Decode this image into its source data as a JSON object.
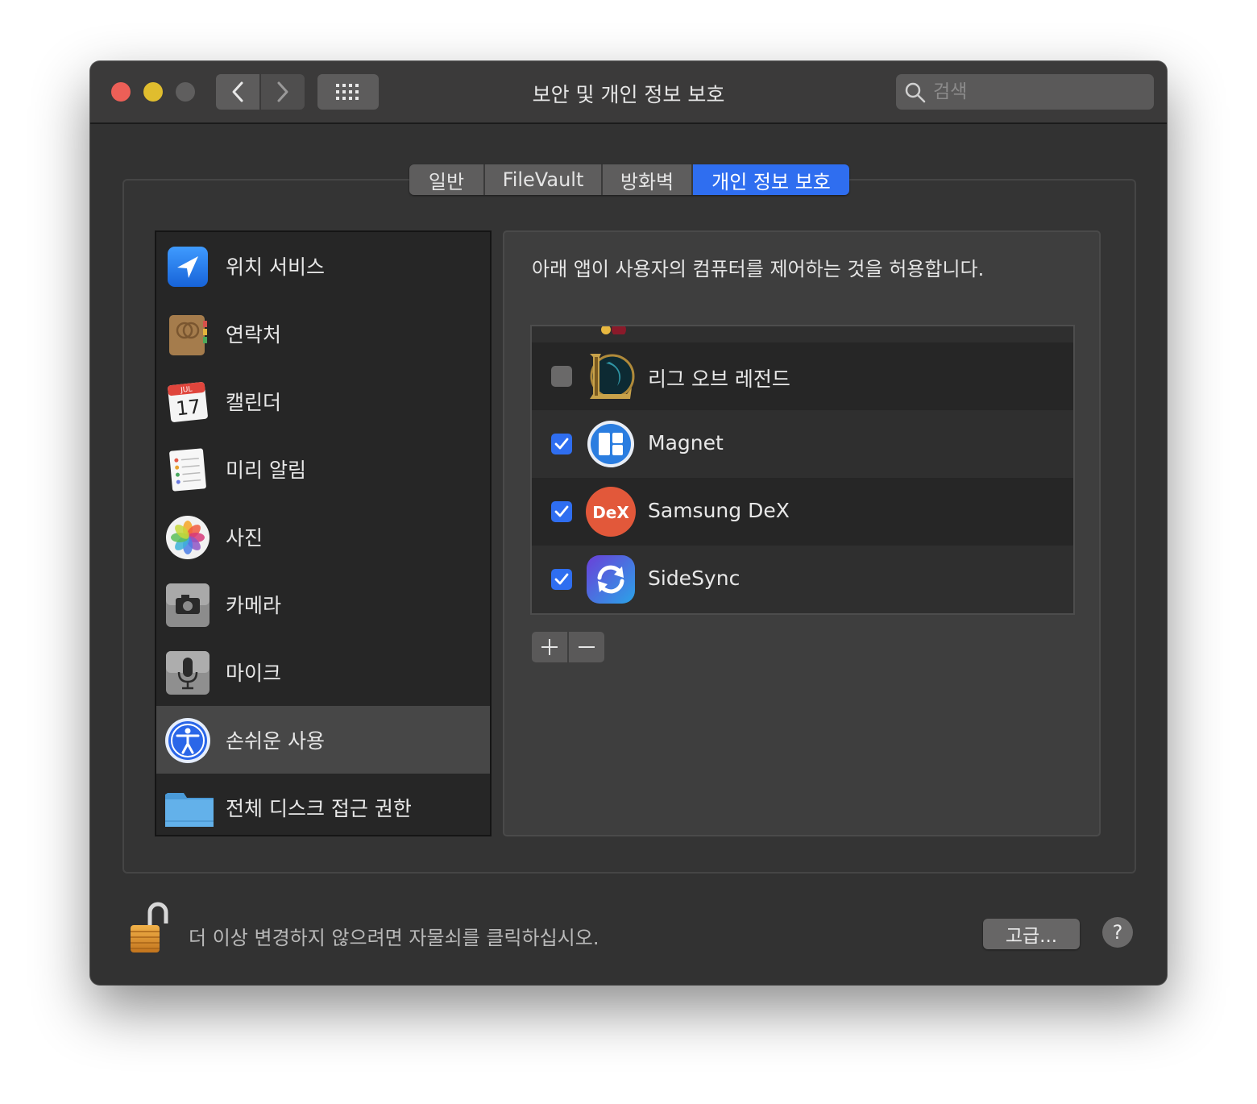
{
  "window": {
    "title": "보안 및 개인 정보 보호",
    "search_placeholder": "검색"
  },
  "tabs": [
    {
      "label": "일반",
      "active": false
    },
    {
      "label": "FileVault",
      "active": false
    },
    {
      "label": "방화벽",
      "active": false
    },
    {
      "label": "개인 정보 보호",
      "active": true
    }
  ],
  "sidebar": {
    "items": [
      {
        "label": "위치 서비스",
        "icon": "location-arrow-icon"
      },
      {
        "label": "연락처",
        "icon": "contacts-book-icon"
      },
      {
        "label": "캘린더",
        "icon": "calendar-icon",
        "month": "JUL",
        "day": "17"
      },
      {
        "label": "미리 알림",
        "icon": "reminders-icon"
      },
      {
        "label": "사진",
        "icon": "photos-icon"
      },
      {
        "label": "카메라",
        "icon": "camera-icon"
      },
      {
        "label": "마이크",
        "icon": "microphone-icon"
      },
      {
        "label": "손쉬운 사용",
        "icon": "accessibility-icon",
        "selected": true
      },
      {
        "label": "전체 디스크 접근 권한",
        "icon": "folder-icon"
      }
    ]
  },
  "content": {
    "description": "아래 앱이 사용자의 컴퓨터를 제어하는 것을 허용합니다.",
    "apps": [
      {
        "label": "리그 오브 레전드",
        "checked": false,
        "icon": "league-of-legends-icon"
      },
      {
        "label": "Magnet",
        "checked": true,
        "icon": "magnet-icon"
      },
      {
        "label": "Samsung DeX",
        "checked": true,
        "icon": "samsung-dex-icon",
        "icon_text": "DeX"
      },
      {
        "label": "SideSync",
        "checked": true,
        "icon": "sidesync-icon"
      }
    ]
  },
  "footer": {
    "lock_text": "더 이상 변경하지 않으려면 자물쇠를 클릭하십시오.",
    "advanced_label": "고급...",
    "help_label": "?"
  },
  "colors": {
    "accent": "#2f6ef0",
    "close": "#ec5f57",
    "minimize": "#e0bd2e"
  }
}
